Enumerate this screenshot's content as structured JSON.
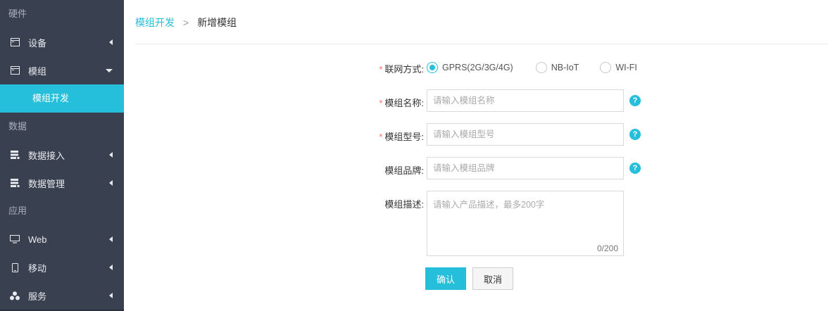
{
  "sidebar": {
    "sections": [
      {
        "title": "硬件"
      },
      {
        "title": "数据"
      },
      {
        "title": "应用"
      }
    ],
    "items": [
      {
        "label": "设备",
        "icon": "window-icon"
      },
      {
        "label": "模组",
        "icon": "window-icon"
      },
      {
        "label": "模组开发"
      },
      {
        "label": "数据接入",
        "icon": "database-icon"
      },
      {
        "label": "数据管理",
        "icon": "database-icon"
      },
      {
        "label": "Web",
        "icon": "monitor-icon"
      },
      {
        "label": "移动",
        "icon": "mobile-icon"
      },
      {
        "label": "服务",
        "icon": "cluster-icon"
      }
    ]
  },
  "breadcrumb": {
    "parent": "模组开发",
    "separator": ">",
    "current": "新增模组"
  },
  "form": {
    "network": {
      "label": "联网方式:",
      "options": [
        "GPRS(2G/3G/4G)",
        "NB-IoT",
        "WI-FI"
      ],
      "selected": "GPRS(2G/3G/4G)"
    },
    "name": {
      "label": "模组名称:",
      "placeholder": "请输入模组名称",
      "help": "?"
    },
    "model": {
      "label": "模组型号:",
      "placeholder": "请输入模组型号",
      "help": "?"
    },
    "brand": {
      "label": "模组品牌:",
      "placeholder": "请输入模组品牌",
      "help": "?"
    },
    "description": {
      "label": "模组描述:",
      "placeholder": "请输入产品描述，最多200字",
      "counter": "0/200"
    },
    "required_mark": "*"
  },
  "buttons": {
    "confirm": "确认",
    "cancel": "取消"
  },
  "colors": {
    "accent": "#25bfdc",
    "sidebar_bg": "#394150",
    "required": "#ff6a6a"
  }
}
